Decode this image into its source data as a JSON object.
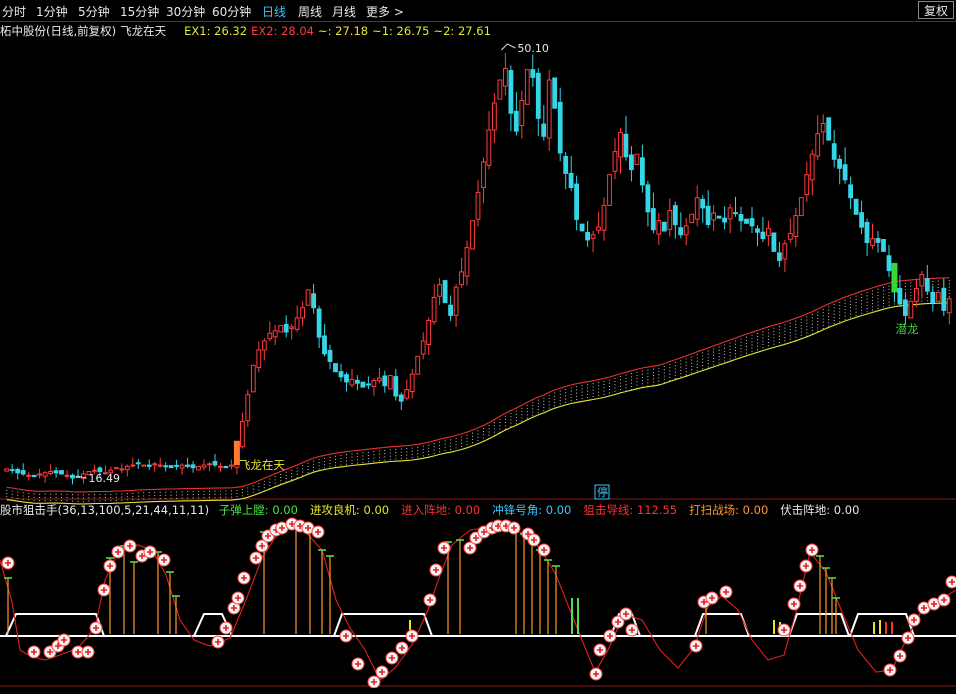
{
  "toolbar": {
    "periods": [
      {
        "label": "分时",
        "active": false
      },
      {
        "label": "1分钟",
        "active": false
      },
      {
        "label": "5分钟",
        "active": false
      },
      {
        "label": "15分钟",
        "active": false
      },
      {
        "label": "30分钟",
        "active": false
      },
      {
        "label": "60分钟",
        "active": false
      },
      {
        "label": "日线",
        "active": true
      },
      {
        "label": "周线",
        "active": false
      },
      {
        "label": "月线",
        "active": false
      },
      {
        "label": "更多 >",
        "active": false
      }
    ],
    "fuquan_label": "复权"
  },
  "main_chart": {
    "title": "柘中股份(日线,前复权)",
    "indicator_name": "飞龙在天",
    "ex1_label": "EX1: 26.32",
    "ex2_label": "EX2: 28.04",
    "tilde_label": "~: 27.18",
    "tilde1_label": "~1: 26.75",
    "tilde2_label": "~2: 27.61",
    "high_label": "50.10",
    "low_label": "16.49",
    "signal_text_1": "飞龙在天",
    "signal_text_2": "潜龙",
    "stop_badge": "停",
    "colors": {
      "up": "#ff3b3b",
      "down": "#35d6e6",
      "ma_red": "#e83030",
      "ma_yellow": "#e6e62c"
    }
  },
  "chart_data": {
    "type": "candlestick",
    "title": "柘中股份(日线,前复权)",
    "high": 50.1,
    "low": 16.49,
    "overlay_lines": [
      {
        "name": "EX1",
        "last": 26.32
      },
      {
        "name": "EX2",
        "last": 28.04
      }
    ],
    "closes": [
      17.2,
      17.1,
      16.9,
      16.8,
      16.7,
      16.6,
      16.8,
      16.9,
      17.0,
      16.9,
      16.8,
      16.7,
      16.5,
      16.6,
      16.8,
      17.0,
      17.1,
      17.0,
      16.9,
      17.1,
      17.3,
      17.2,
      17.4,
      17.5,
      17.6,
      17.5,
      17.4,
      17.6,
      17.5,
      17.4,
      17.3,
      17.4,
      17.5,
      17.4,
      17.3,
      17.4,
      17.5,
      17.6,
      17.5,
      17.4,
      17.3,
      17.5,
      19.0,
      20.9,
      23.0,
      25.3,
      26.5,
      27.2,
      27.8,
      28.0,
      28.4,
      27.9,
      28.3,
      29.0,
      29.8,
      31.2,
      29.8,
      27.5,
      26.2,
      25.6,
      24.8,
      24.4,
      24.0,
      24.2,
      23.9,
      23.6,
      23.8,
      24.1,
      24.3,
      23.7,
      24.5,
      22.9,
      22.5,
      23.4,
      24.6,
      26.0,
      27.2,
      28.8,
      30.6,
      31.6,
      30.2,
      29.2,
      31.4,
      32.6,
      34.5,
      36.6,
      38.8,
      41.2,
      43.7,
      45.8,
      47.6,
      48.5,
      45.0,
      43.6,
      46.0,
      48.4,
      47.8,
      44.6,
      43.2,
      47.6,
      45.4,
      41.9,
      40.3,
      39.2,
      36.7,
      35.8,
      35.1,
      35.5,
      36.1,
      37.8,
      40.2,
      42.0,
      43.5,
      41.6,
      40.6,
      41.8,
      39.4,
      37.3,
      35.9,
      36.6,
      35.8,
      37.4,
      36.3,
      35.5,
      36.2,
      37.1,
      38.4,
      37.6,
      36.3,
      37.2,
      36.8,
      36.5,
      37.6,
      37.2,
      36.6,
      36.4,
      36.2,
      35.7,
      35.2,
      36.0,
      34.2,
      33.5,
      34.8,
      35.6,
      37.0,
      38.4,
      40.2,
      41.8,
      43.4,
      44.2,
      42.9,
      41.4,
      40.7,
      39.8,
      38.4,
      37.1,
      36.1,
      34.9,
      35.2,
      34.9,
      34.2,
      32.7,
      31.2,
      30.1,
      29.2,
      30.3,
      31.3,
      32.4,
      31.1,
      30.2,
      31.0,
      29.6,
      30.5
    ],
    "subchart": {
      "name": "股市狙击手",
      "params": "(36,13,100,5,21,44,11,11)",
      "values": [
        {
          "label": "子弹上膛",
          "value": "0.00",
          "color": "#4be04b"
        },
        {
          "label": "进攻良机",
          "value": "0.00",
          "color": "#e6e62c"
        },
        {
          "label": "进入阵地",
          "value": "0.00",
          "color": "#ff3030"
        },
        {
          "label": "冲锋号角",
          "value": "0.00",
          "color": "#35c8ff"
        },
        {
          "label": "狙击导线",
          "value": "112.55",
          "color": "#ff3030"
        },
        {
          "label": "打扫战场",
          "value": "0.00",
          "color": "#ff9a2c"
        },
        {
          "label": "伏击阵地",
          "value": "0.00",
          "color": "#e8e8e8"
        }
      ]
    }
  },
  "subchart": {
    "name": "股市狙击手(36,13,100,5,21,44,11,11)"
  }
}
